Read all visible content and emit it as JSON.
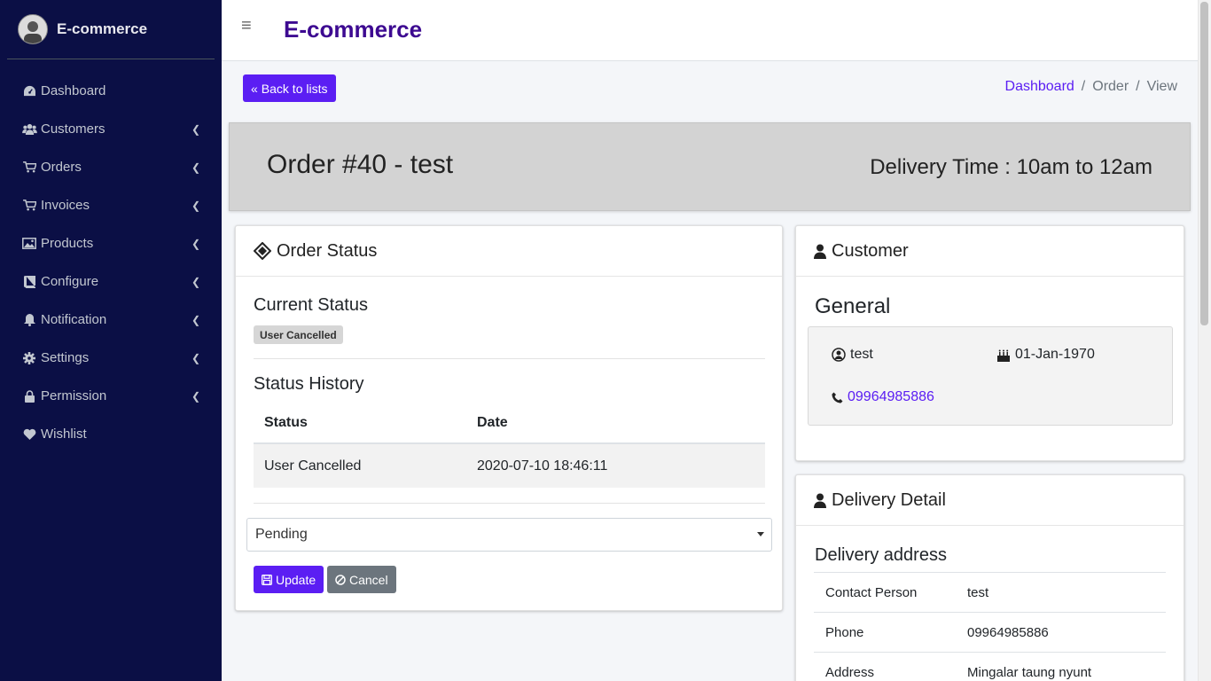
{
  "sidebar": {
    "brand": "E-commerce",
    "items": [
      {
        "label": "Dashboard",
        "icon": "dashboard-icon",
        "has_submenu": false
      },
      {
        "label": "Customers",
        "icon": "users-icon",
        "has_submenu": true
      },
      {
        "label": "Orders",
        "icon": "cart-icon",
        "has_submenu": true
      },
      {
        "label": "Invoices",
        "icon": "cart-icon",
        "has_submenu": true
      },
      {
        "label": "Products",
        "icon": "image-icon",
        "has_submenu": true
      },
      {
        "label": "Configure",
        "icon": "book-icon",
        "has_submenu": true
      },
      {
        "label": "Notification",
        "icon": "bell-icon",
        "has_submenu": true
      },
      {
        "label": "Settings",
        "icon": "gear-icon",
        "has_submenu": true
      },
      {
        "label": "Permission",
        "icon": "lock-icon",
        "has_submenu": true
      },
      {
        "label": "Wishlist",
        "icon": "heart-icon",
        "has_submenu": false
      }
    ]
  },
  "header": {
    "title": "E-commerce"
  },
  "toolbar": {
    "back_label": "Back to lists"
  },
  "breadcrumb": {
    "items": [
      "Dashboard",
      "Order",
      "View"
    ]
  },
  "order": {
    "title": "Order #40 - test",
    "delivery_time": "Delivery Time : 10am to 12am"
  },
  "status_card": {
    "header": "Order Status",
    "current_status_label": "Current Status",
    "current_status": "User Cancelled",
    "history_title": "Status History",
    "columns": [
      "Status",
      "Date"
    ],
    "rows": [
      [
        "User Cancelled",
        "2020-07-10 18:46:11"
      ]
    ],
    "select_value": "Pending",
    "update_label": "Update",
    "cancel_label": "Cancel"
  },
  "customer_card": {
    "header": "Customer",
    "general_title": "General",
    "name": "test",
    "birthday": "01-Jan-1970",
    "phone": "09964985886"
  },
  "delivery_card": {
    "header": "Delivery Detail",
    "address_title": "Delivery address",
    "rows": [
      {
        "key": "Contact Person",
        "value": "test"
      },
      {
        "key": "Phone",
        "value": "09964985886"
      },
      {
        "key": "Address",
        "value": "Mingalar taung nyunt"
      }
    ]
  },
  "colors": {
    "sidebar_bg": "#0b0f45",
    "accent": "#5b1ef3",
    "title": "#3d0a91",
    "banner_bg": "#d3d3d3"
  }
}
